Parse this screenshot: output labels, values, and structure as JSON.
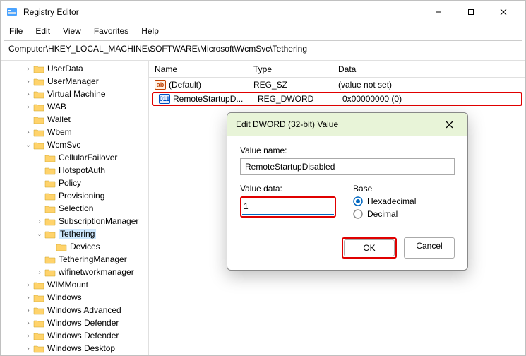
{
  "window": {
    "title": "Registry Editor"
  },
  "menu": {
    "file": "File",
    "edit": "Edit",
    "view": "View",
    "favorites": "Favorites",
    "help": "Help"
  },
  "address": "Computer\\HKEY_LOCAL_MACHINE\\SOFTWARE\\Microsoft\\WcmSvc\\Tethering",
  "columns": {
    "name": "Name",
    "type": "Type",
    "data": "Data"
  },
  "rows": [
    {
      "name": "(Default)",
      "type": "REG_SZ",
      "data": "(value not set)",
      "icon": "ab"
    },
    {
      "name": "RemoteStartupD...",
      "type": "REG_DWORD",
      "data": "0x00000000 (0)",
      "icon": "011"
    }
  ],
  "tree": {
    "n0": "UserData",
    "n1": "UserManager",
    "n2": "Virtual Machine",
    "n3": "WAB",
    "n4": "Wallet",
    "n5": "Wbem",
    "n6": "WcmSvc",
    "n6a": "CellularFailover",
    "n6b": "HotspotAuth",
    "n6c": "Policy",
    "n6d": "Provisioning",
    "n6e": "Selection",
    "n6f": "SubscriptionManager",
    "n6g": "Tethering",
    "n6g1": "Devices",
    "n6h": "TetheringManager",
    "n6i": "wifinetworkmanager",
    "n7": "WIMMount",
    "n8": "Windows",
    "n9": "Windows Advanced",
    "n10": "Windows Defender",
    "n11": "Windows Defender",
    "n12": "Windows Desktop"
  },
  "dialog": {
    "title": "Edit DWORD (32-bit) Value",
    "valuename_label": "Value name:",
    "valuename": "RemoteStartupDisabled",
    "valuedata_label": "Value data:",
    "valuedata": "1",
    "base_label": "Base",
    "hex": "Hexadecimal",
    "dec": "Decimal",
    "ok": "OK",
    "cancel": "Cancel"
  }
}
